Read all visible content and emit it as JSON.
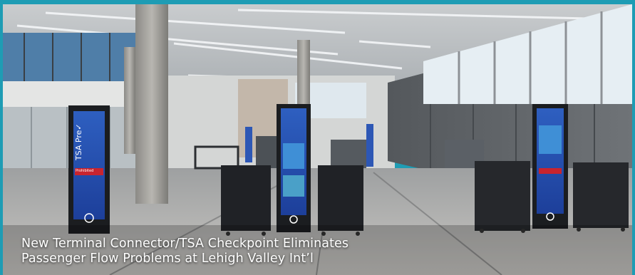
{
  "image": {
    "caption_line1": "New Terminal Connector/TSA Checkpoint Eliminates",
    "caption_line2": "Passenger Flow Problems at Lehigh Valley Int’l",
    "kiosk_brand": "TSA Pre✓",
    "kiosk_left_banner": "Prohibited",
    "frame_color": "#1e9cb4",
    "photo_scene": "airport TSA checkpoint interior"
  }
}
